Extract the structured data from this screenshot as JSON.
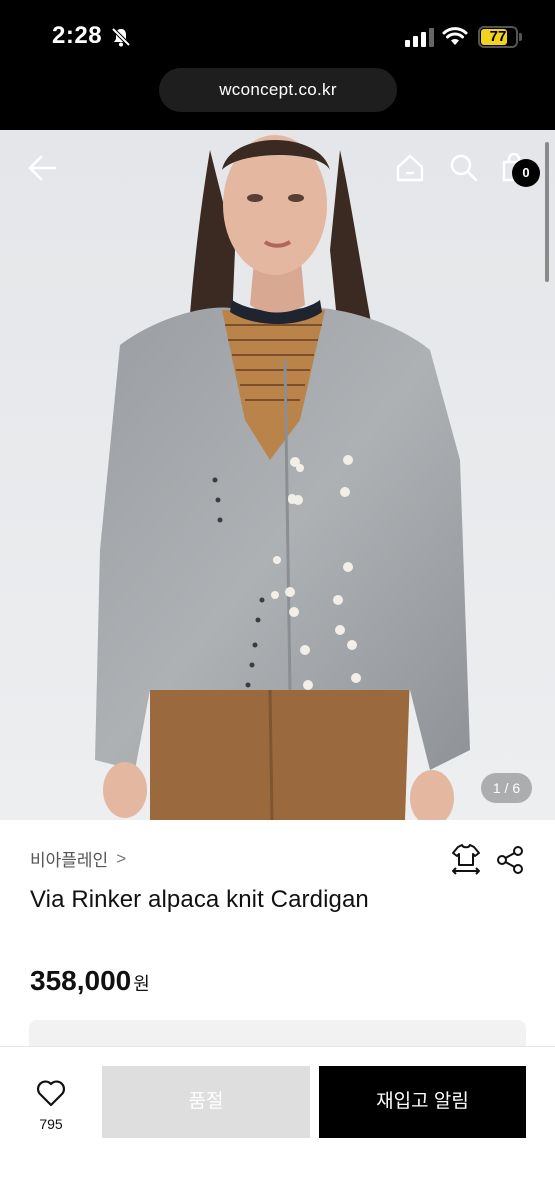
{
  "status_bar": {
    "time": "2:28",
    "battery": "77",
    "battery_level": 0.77,
    "accent_color": "#f2d21f"
  },
  "browser": {
    "url": "wconcept.co.kr"
  },
  "hero": {
    "image_counter": "1 / 6",
    "cart_count": "0",
    "icons": [
      "back-arrow-icon",
      "home-icon",
      "search-icon",
      "shopping-bag-icon"
    ]
  },
  "product": {
    "brand": "비아플레인",
    "brand_chevron": ">",
    "name": "Via Rinker alpaca knit Cardigan",
    "price": "358,000",
    "price_unit": "원"
  },
  "bottom_bar": {
    "wish_count": "795",
    "soldout_label": "품절",
    "restock_label": "재입고 알림"
  }
}
